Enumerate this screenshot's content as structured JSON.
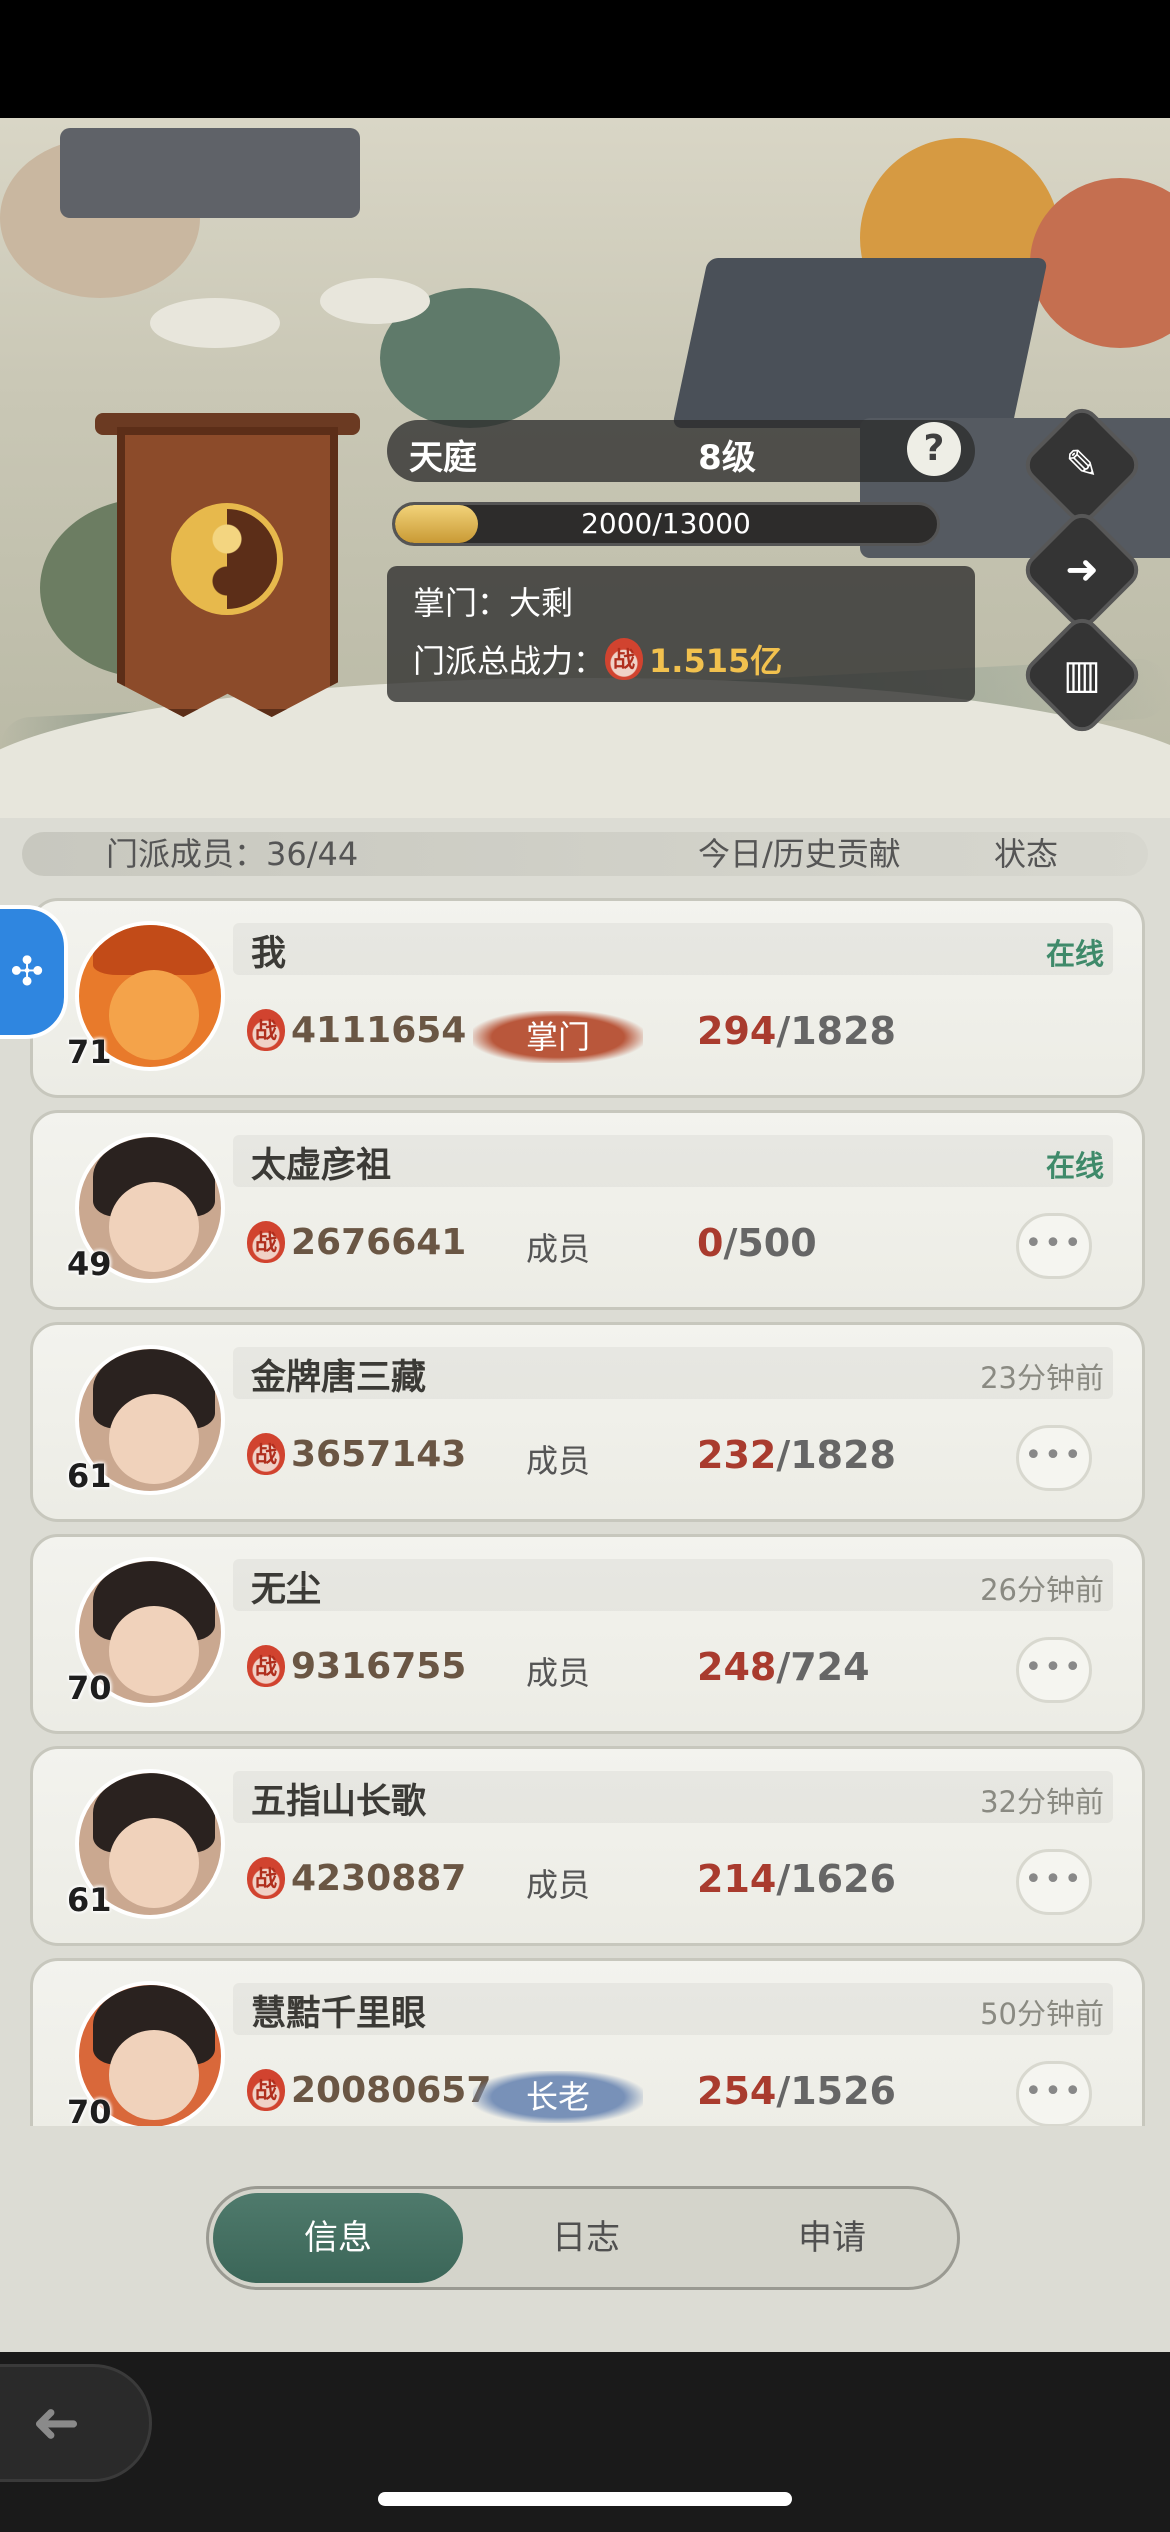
{
  "sect": {
    "name": "天庭",
    "level": "8级",
    "progress_text": "2000/13000",
    "progress_fraction": 0.154,
    "leader_label": "掌门：大剩",
    "power_label": "门派总战力：",
    "power_total": "1.515亿"
  },
  "icons": {
    "help": "?",
    "edit": "✎",
    "exit": "➜",
    "ranking": "▥",
    "power_glyph": "战",
    "assistant": "✣",
    "back": "➜",
    "more": "•••"
  },
  "list_header": {
    "members": "门派成员：36/44",
    "contribution": "今日/历史贡献",
    "status": "状态"
  },
  "members": [
    {
      "level": "71",
      "name": "我",
      "status": "在线",
      "power": "4111654",
      "role": "掌门",
      "today": "294",
      "total": "/1828"
    },
    {
      "level": "49",
      "name": "太虚彦祖",
      "status": "在线",
      "power": "2676641",
      "role": "成员",
      "today": "0",
      "total": "/500"
    },
    {
      "level": "61",
      "name": "金牌唐三藏",
      "status": "23分钟前",
      "power": "3657143",
      "role": "成员",
      "today": "232",
      "total": "/1828"
    },
    {
      "level": "70",
      "name": "无尘",
      "status": "26分钟前",
      "power": "9316755",
      "role": "成员",
      "today": "248",
      "total": "/724"
    },
    {
      "level": "61",
      "name": "五指山长歌",
      "status": "32分钟前",
      "power": "4230887",
      "role": "成员",
      "today": "214",
      "total": "/1626"
    },
    {
      "level": "70",
      "name": "慧黠千里眼",
      "status": "50分钟前",
      "power": "20080657",
      "role": "长老",
      "today": "254",
      "total": "/1526"
    }
  ],
  "tabs": [
    "信息",
    "日志",
    "申请"
  ],
  "colors": {
    "accent_green": "#3f8a6a",
    "contribution_red": "#a93b2e",
    "total_power_gold": "#f2c14e",
    "active_tab": "#4f7a6c"
  }
}
